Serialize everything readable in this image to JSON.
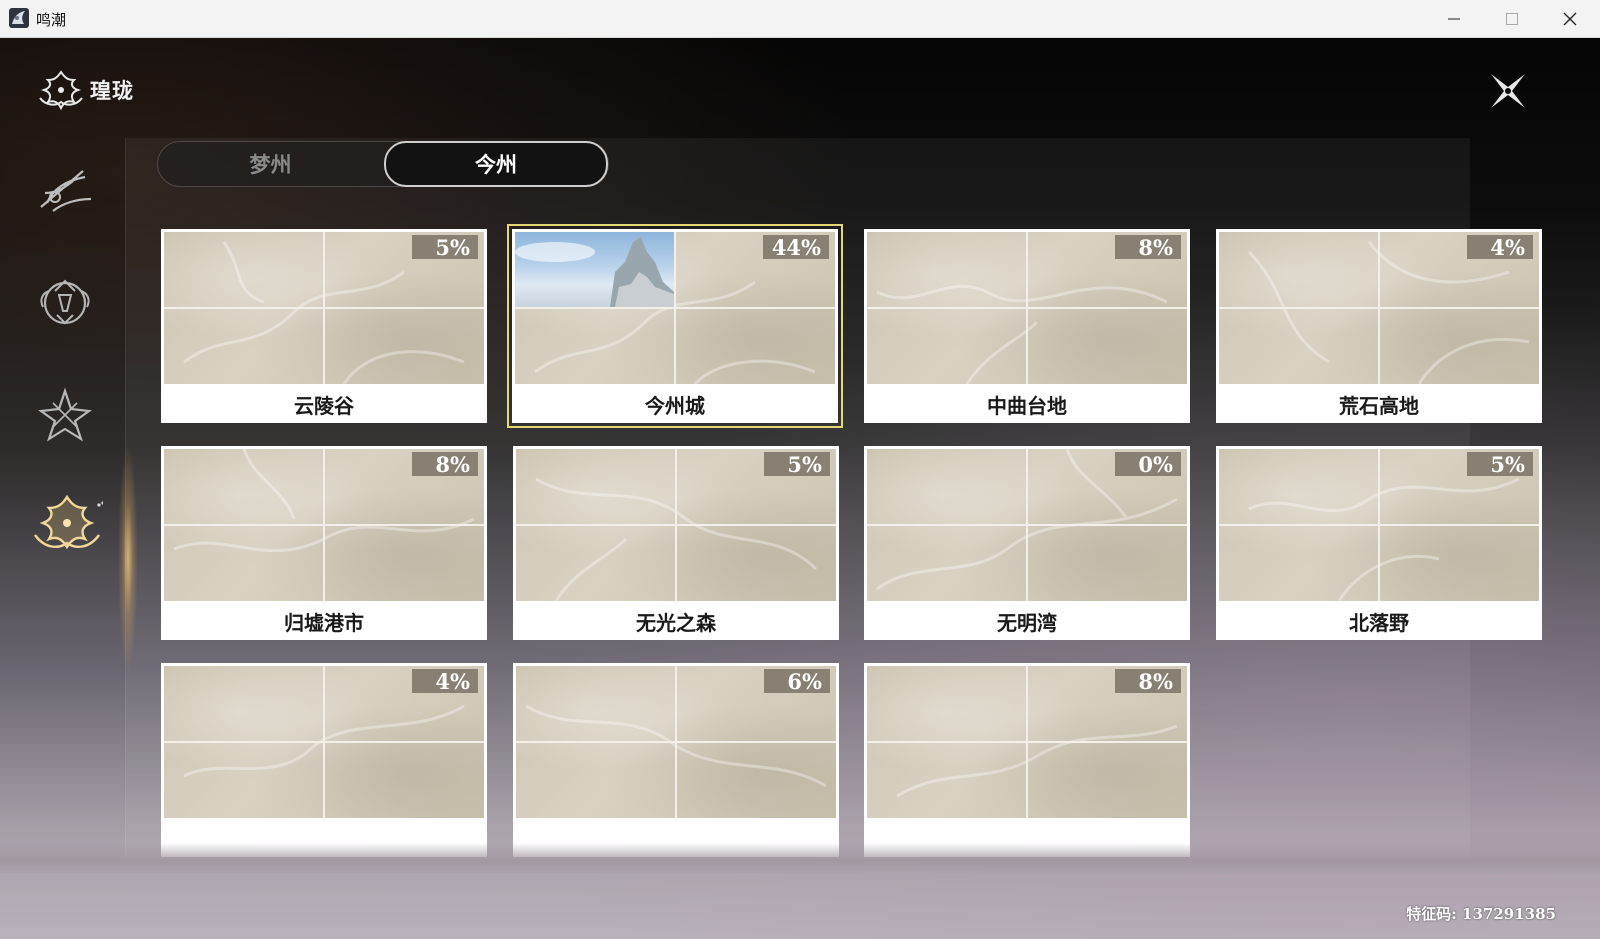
{
  "window": {
    "title": "鸣潮"
  },
  "brand": {
    "title": "瑝珑"
  },
  "sidebar": {
    "items": [
      {
        "icon": "spear-emblem-icon"
      },
      {
        "icon": "crest-emblem-icon"
      },
      {
        "icon": "star-emblem-icon"
      },
      {
        "icon": "dragon-emblem-icon",
        "active": true
      }
    ]
  },
  "tabs": [
    {
      "label": "梦州",
      "active": false
    },
    {
      "label": "今州",
      "active": true
    }
  ],
  "regions": [
    {
      "name": "云陵谷",
      "percent": "5%"
    },
    {
      "name": "今州城",
      "percent": "44%",
      "selected": true
    },
    {
      "name": "中曲台地",
      "percent": "8%"
    },
    {
      "name": "荒石高地",
      "percent": "4%"
    },
    {
      "name": "归墟港市",
      "percent": "8%"
    },
    {
      "name": "无光之森",
      "percent": "5%"
    },
    {
      "name": "无明湾",
      "percent": "0%"
    },
    {
      "name": "北落野",
      "percent": "5%"
    },
    {
      "name": "",
      "percent": "4%"
    },
    {
      "name": "",
      "percent": "6%"
    },
    {
      "name": "",
      "percent": "8%"
    }
  ],
  "footer": {
    "feature_code": "特征码: 137291385"
  },
  "colors": {
    "selected_outline": "#e4d675",
    "badge_bg": "#807a6c",
    "map_base": "#d6cfbf"
  }
}
